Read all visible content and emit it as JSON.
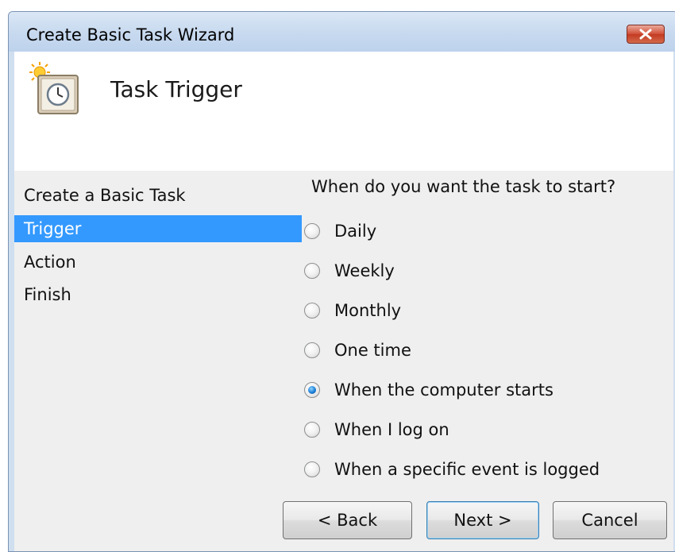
{
  "window": {
    "title": "Create Basic Task Wizard",
    "close_icon": "close-icon"
  },
  "header": {
    "icon": "task-clock-icon",
    "title": "Task Trigger"
  },
  "steps": [
    {
      "label": "Create a Basic Task",
      "selected": false
    },
    {
      "label": "Trigger",
      "selected": true
    },
    {
      "label": "Action",
      "selected": false
    },
    {
      "label": "Finish",
      "selected": false
    }
  ],
  "trigger": {
    "question": "When do you want the task to start?",
    "options": [
      {
        "label": "Daily",
        "checked": false
      },
      {
        "label": "Weekly",
        "checked": false
      },
      {
        "label": "Monthly",
        "checked": false
      },
      {
        "label": "One time",
        "checked": false
      },
      {
        "label": "When the computer starts",
        "checked": true
      },
      {
        "label": "When I log on",
        "checked": false
      },
      {
        "label": "When a specific event is logged",
        "checked": false
      }
    ]
  },
  "buttons": {
    "back": "< Back",
    "next": "Next >",
    "cancel": "Cancel"
  },
  "colors": {
    "selection": "#3399ff",
    "frame": "#cfdff0",
    "close_red": "#c23a22"
  }
}
